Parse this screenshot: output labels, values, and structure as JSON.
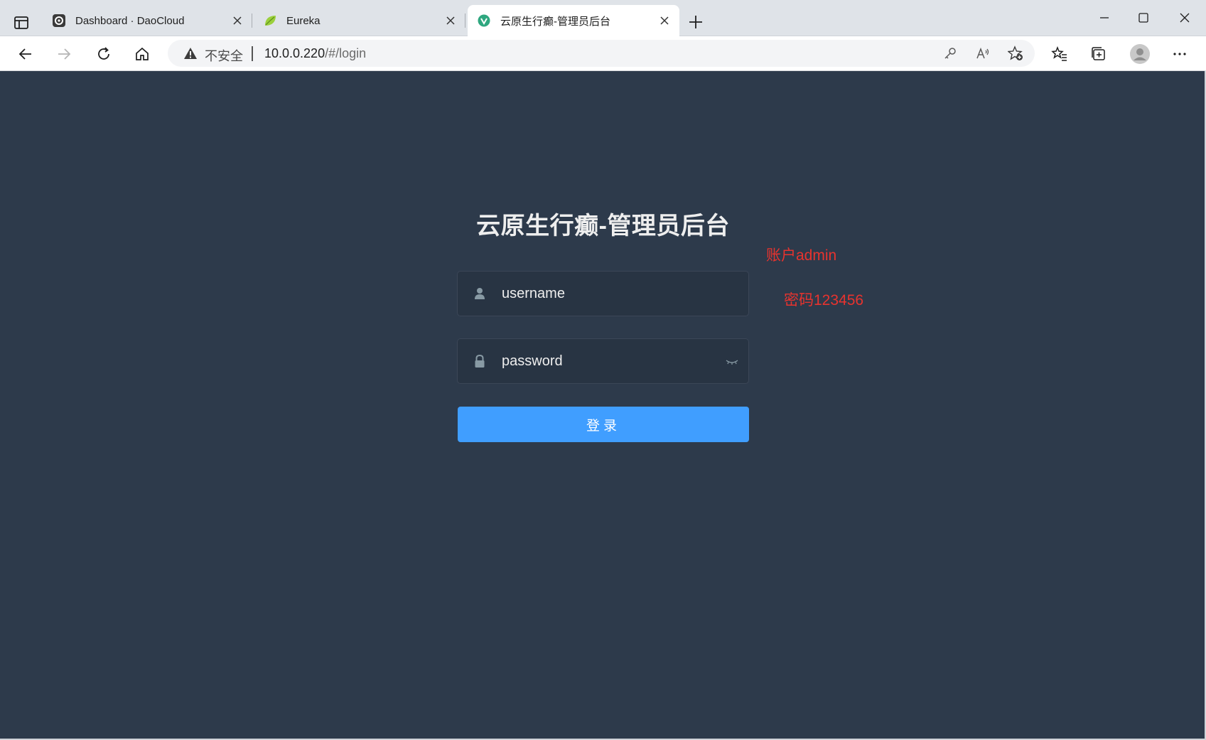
{
  "browser": {
    "tabs": [
      {
        "title": "Dashboard · DaoCloud",
        "icon": "daocloud-icon",
        "active": false
      },
      {
        "title": "Eureka",
        "icon": "spring-leaf-icon",
        "active": false
      },
      {
        "title": "云原生行癫-管理员后台",
        "icon": "vue-icon",
        "active": true
      }
    ],
    "address": {
      "security_label": "不安全",
      "url_host": "10.0.0.220",
      "url_path": "/#/login"
    }
  },
  "login": {
    "title": "云原生行癫-管理员后台",
    "username_text": "username",
    "password_text": "password",
    "submit_label": "登录",
    "accent_color": "#409eff",
    "background_color": "#2d3a4b"
  },
  "annotations": {
    "account_note": "账户admin",
    "password_note": "密码123456",
    "color": "#e8332e"
  }
}
